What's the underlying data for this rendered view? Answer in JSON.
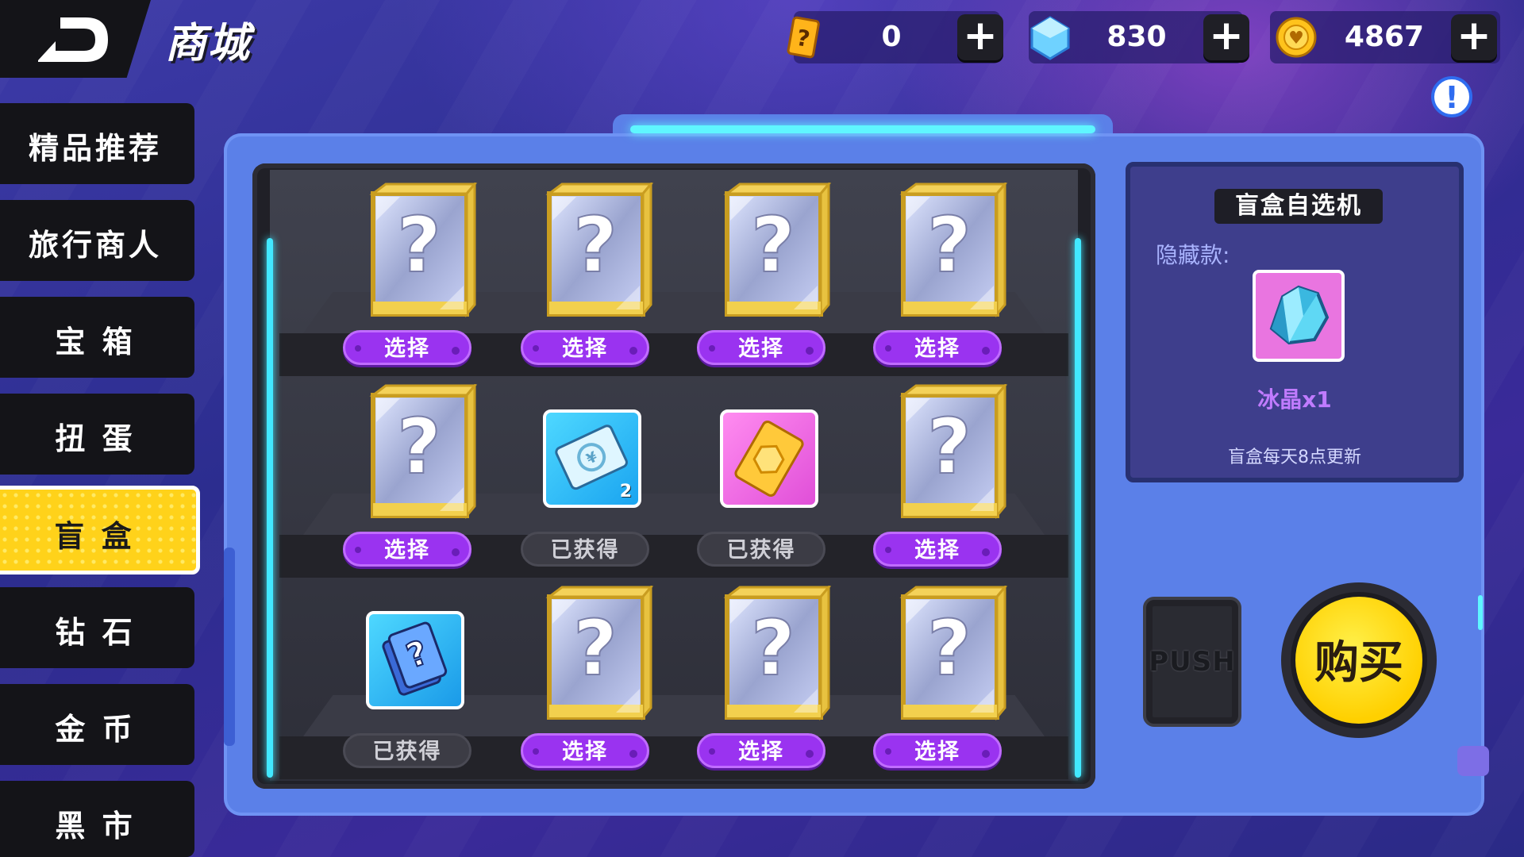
{
  "header": {
    "title": "商城",
    "currencies": [
      {
        "icon": "mystery-ticket-icon",
        "value": "0"
      },
      {
        "icon": "diamond-icon",
        "value": "830"
      },
      {
        "icon": "gold-coin-icon",
        "value": "4867"
      }
    ],
    "plus_label": "+",
    "info_label": "!"
  },
  "sidebar": {
    "items": [
      {
        "label": "精品推荐",
        "active": false
      },
      {
        "label": "旅行商人",
        "active": false
      },
      {
        "label": "宝 箱",
        "active": false
      },
      {
        "label": "扭 蛋",
        "active": false
      },
      {
        "label": "盲 盒",
        "active": true
      },
      {
        "label": "钻 石",
        "active": false
      },
      {
        "label": "金 币",
        "active": false
      },
      {
        "label": "黑 市",
        "active": false
      }
    ]
  },
  "shelves": {
    "select_label": "选择",
    "owned_label": "已获得",
    "rows": [
      [
        {
          "type": "mystery-box",
          "state": "select"
        },
        {
          "type": "mystery-box",
          "state": "select"
        },
        {
          "type": "mystery-box",
          "state": "select"
        },
        {
          "type": "mystery-box",
          "state": "select"
        }
      ],
      [
        {
          "type": "mystery-box",
          "state": "select"
        },
        {
          "type": "blue-coupon",
          "state": "owned",
          "count": "2"
        },
        {
          "type": "gold-ticket",
          "state": "owned"
        },
        {
          "type": "mystery-box",
          "state": "select"
        }
      ],
      [
        {
          "type": "mystery-card",
          "state": "owned"
        },
        {
          "type": "mystery-box",
          "state": "select"
        },
        {
          "type": "mystery-box",
          "state": "select"
        },
        {
          "type": "mystery-box",
          "state": "select"
        }
      ]
    ]
  },
  "selector_panel": {
    "title": "盲盒自选机",
    "hidden_label": "隐藏款:",
    "prize_icon": "ice-crystal-icon",
    "prize_name": "冰晶x1",
    "note": "盲盒每天8点更新"
  },
  "actions": {
    "push_label": "PUSH",
    "buy_label": "购买"
  },
  "colors": {
    "accent_purple": "#9a33f0",
    "active_tab_yellow": "#ffd21a",
    "neon_cyan": "#42e8ff",
    "panel_blue": "#5b80e8"
  }
}
